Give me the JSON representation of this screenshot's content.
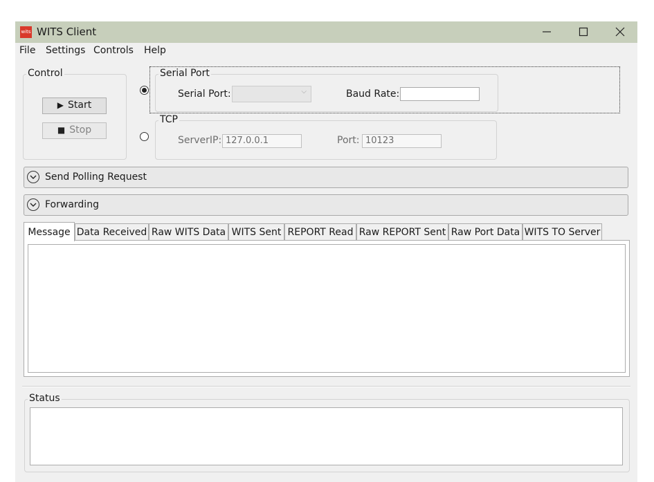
{
  "window": {
    "title": "WITS Client",
    "icon_text": "wits"
  },
  "menu": [
    "File",
    "Settings",
    "Controls",
    "Help"
  ],
  "control": {
    "title": "Control",
    "start_label": "Start",
    "stop_label": "Stop"
  },
  "serial": {
    "title": "Serial Port",
    "port_label": "Serial Port:",
    "port_value": "",
    "baud_label": "Baud Rate:",
    "baud_value": ""
  },
  "tcp": {
    "title": "TCP",
    "ip_label": "ServerIP:",
    "ip_value": "127.0.0.1",
    "port_label": "Port:",
    "port_value": "10123"
  },
  "expanders": [
    "Send Polling Request",
    "Forwarding"
  ],
  "tabs": [
    "Message",
    "Data Received",
    "Raw WITS Data",
    "WITS Sent",
    "REPORT Read",
    "Raw REPORT Sent",
    "Raw Port Data",
    "WITS TO Server"
  ],
  "status": {
    "title": "Status"
  }
}
